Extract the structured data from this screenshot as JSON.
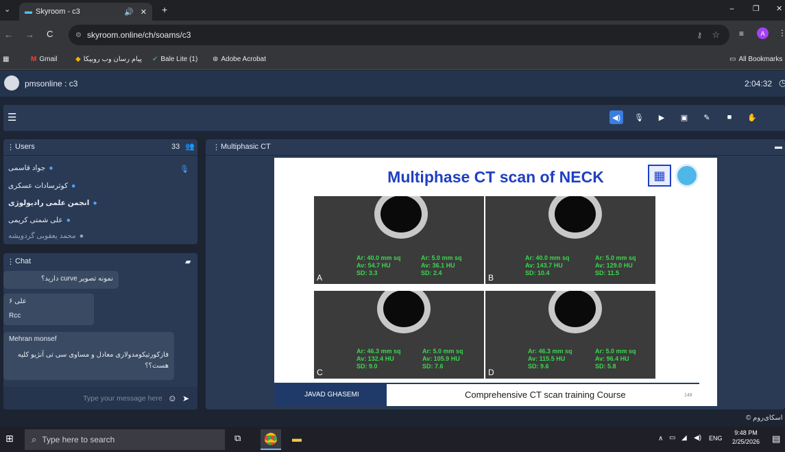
{
  "browser": {
    "tab_title": "Skyroom - c3",
    "url": "skyroom.online/ch/soams/c3",
    "profile_initial": "A",
    "bookmarks": [
      "Gmail",
      "پیام رسان وب روبیکا",
      "Bale Lite (1)",
      "Adobe Acrobat"
    ],
    "all_bookmarks": "All Bookmarks"
  },
  "room": {
    "title": "pmsonline : c3",
    "timer": "2:04:32"
  },
  "users_panel": {
    "title": "Users",
    "count": "33",
    "users": [
      "جواد قاسمی",
      "کوثرسادات عسکری",
      "انجمن علمی رادیولوژی",
      "علی شمتی کریمی",
      "محمد یعقوبی گردویشه"
    ]
  },
  "chat": {
    "title": "Chat",
    "messages": [
      {
        "author": "",
        "text": "نمونه تصویر curve دارید؟"
      },
      {
        "author": "علی ۶",
        "text": "Rcc"
      },
      {
        "author": "Mehran monsef",
        "text": "فازکورتیکومدولاری معادل و مساوی سی تی آنژیو کلیه هست؟؟"
      }
    ],
    "placeholder": "Type your message here"
  },
  "presentation": {
    "title": "Multiphasic CT",
    "slide_title": "Multiphase CT scan of NECK",
    "footer_left": "JAVAD GHASEMI",
    "footer_right": "Comprehensive CT scan training Course",
    "page_no": "148",
    "panels": [
      {
        "label": "A",
        "left_text": [
          "Ar: 40.0 mm sq",
          "Av: 54.7 HU",
          "SD: 3.3"
        ],
        "right_text": [
          "Ar: 5.0 mm sq",
          "Av: 36.1 HU",
          "SD: 2.4"
        ]
      },
      {
        "label": "B",
        "left_text": [
          "Ar: 40.0 mm sq",
          "Av: 143.7 HU",
          "SD: 10.4"
        ],
        "right_text": [
          "Ar: 5.0 mm sq",
          "Av: 129.0 HU",
          "SD: 11.5"
        ]
      },
      {
        "label": "C",
        "left_text": [
          "Ar: 46.3 mm sq",
          "Av: 132.4 HU",
          "SD: 9.0"
        ],
        "right_text": [
          "Ar: 5.0 mm sq",
          "Av: 105.9 HU",
          "SD: 7.6"
        ]
      },
      {
        "label": "D",
        "left_text": [
          "Ar: 46.3 mm sq",
          "Av: 115.5 HU",
          "SD: 9.6"
        ],
        "right_text": [
          "Ar: 5.0 mm sq",
          "Av: 96.4 HU",
          "SD: 5.8"
        ]
      }
    ]
  },
  "footer": {
    "brand": "اسکای‌روم ©"
  },
  "taskbar": {
    "search_placeholder": "Type here to search",
    "lang": "ENG",
    "time": "9:48 PM",
    "date": "2/25/2026"
  }
}
